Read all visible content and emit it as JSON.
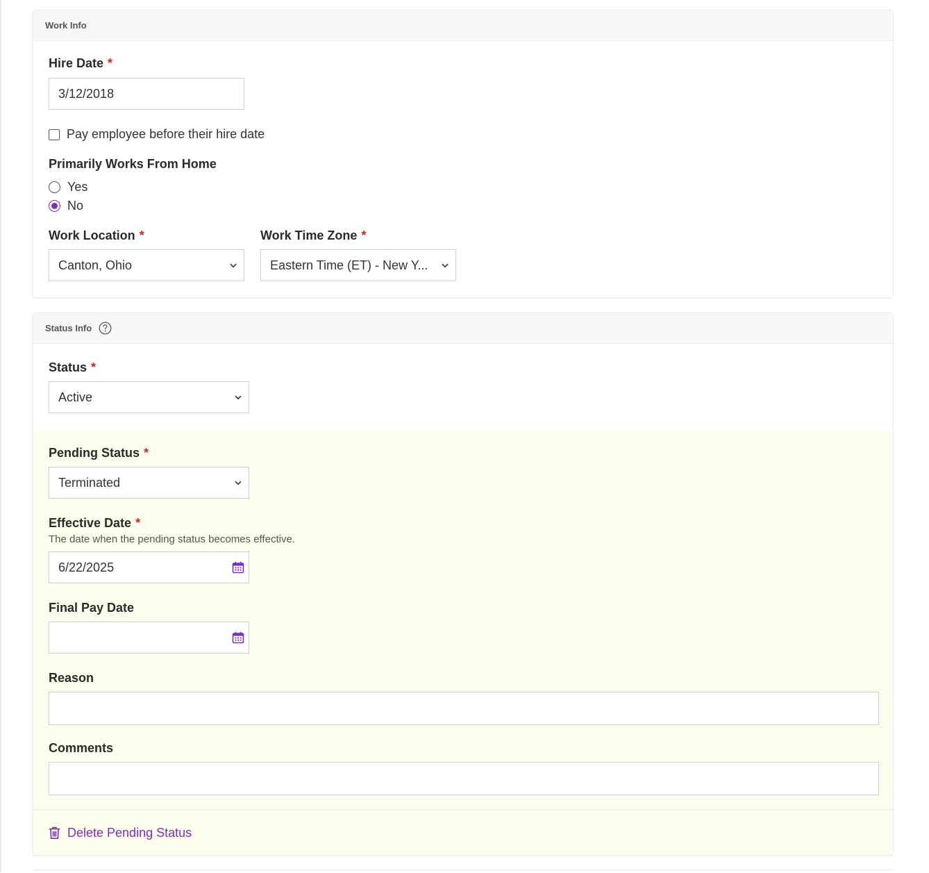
{
  "work_info": {
    "header": "Work Info",
    "hire_date": {
      "label": "Hire Date",
      "required": "*",
      "value": "3/12/2018"
    },
    "pay_before_hire": {
      "label": "Pay employee before their hire date",
      "checked": false
    },
    "works_from_home": {
      "label": "Primarily Works From Home",
      "options": [
        {
          "label": "Yes",
          "checked": false
        },
        {
          "label": "No",
          "checked": true
        }
      ]
    },
    "work_location": {
      "label": "Work Location",
      "required": "*",
      "value": "Canton, Ohio"
    },
    "work_time_zone": {
      "label": "Work Time Zone",
      "required": "*",
      "value": "Eastern Time (ET) - New Y..."
    }
  },
  "status_info": {
    "header": "Status Info",
    "help_icon": "question-circle-icon",
    "status": {
      "label": "Status",
      "required": "*",
      "value": "Active"
    },
    "pending_status": {
      "label": "Pending Status",
      "required": "*",
      "value": "Terminated"
    },
    "effective_date": {
      "label": "Effective Date",
      "required": "*",
      "hint": "The date when the pending status becomes effective.",
      "value": "6/22/2025"
    },
    "final_pay_date": {
      "label": "Final Pay Date",
      "value": ""
    },
    "reason": {
      "label": "Reason",
      "value": ""
    },
    "comments": {
      "label": "Comments",
      "value": ""
    },
    "delete_action": {
      "label": "Delete Pending Status",
      "icon": "trash-icon"
    }
  },
  "colors": {
    "accent": "#7b2fbe",
    "required": "#c8262c",
    "pending_bg": "#fdfdee"
  }
}
